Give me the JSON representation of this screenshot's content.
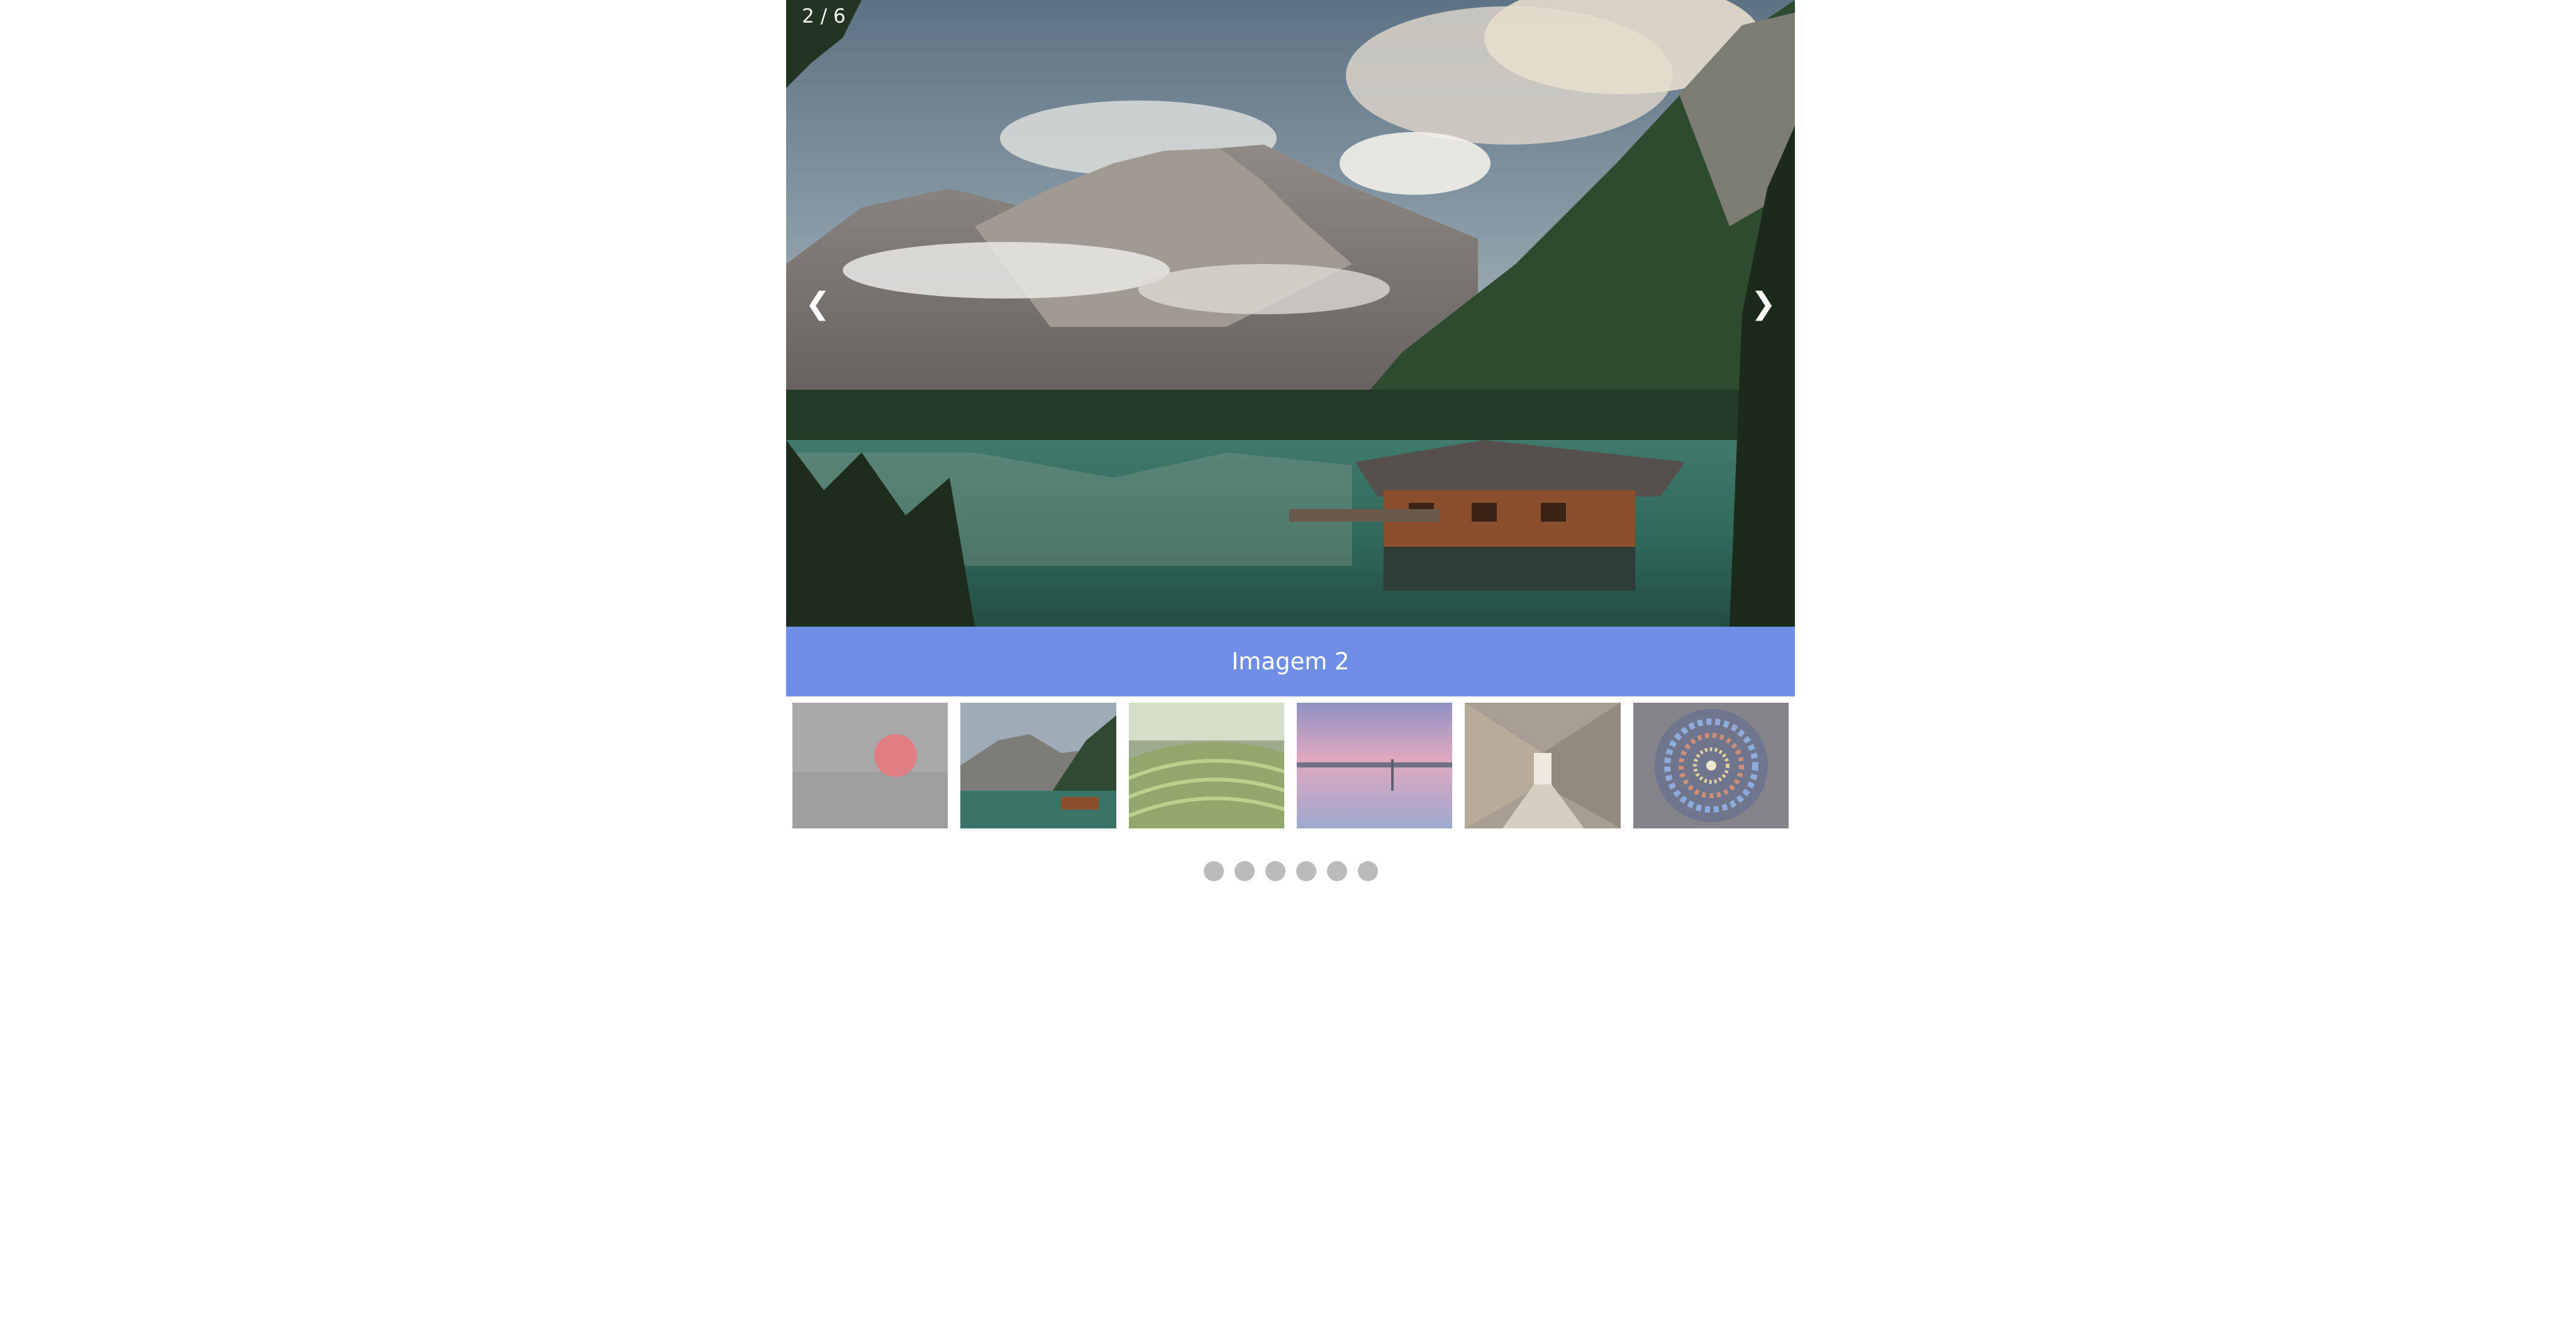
{
  "slideshow": {
    "counter": "2 / 6",
    "prev_label": "❮",
    "next_label": "❯",
    "caption": "Imagem 2",
    "caption_bg": "#6f8fe6",
    "dot_color": "#bbbbbb",
    "total_slides": 6,
    "active_index": 1
  },
  "thumbnails": [
    {
      "subject": "red-sun-in-haze"
    },
    {
      "subject": "mountain-lake-boathouse"
    },
    {
      "subject": "rice-terraces"
    },
    {
      "subject": "pink-sunset-lake"
    },
    {
      "subject": "gothic-cloister-corridor"
    },
    {
      "subject": "stained-glass-rose-window"
    }
  ]
}
